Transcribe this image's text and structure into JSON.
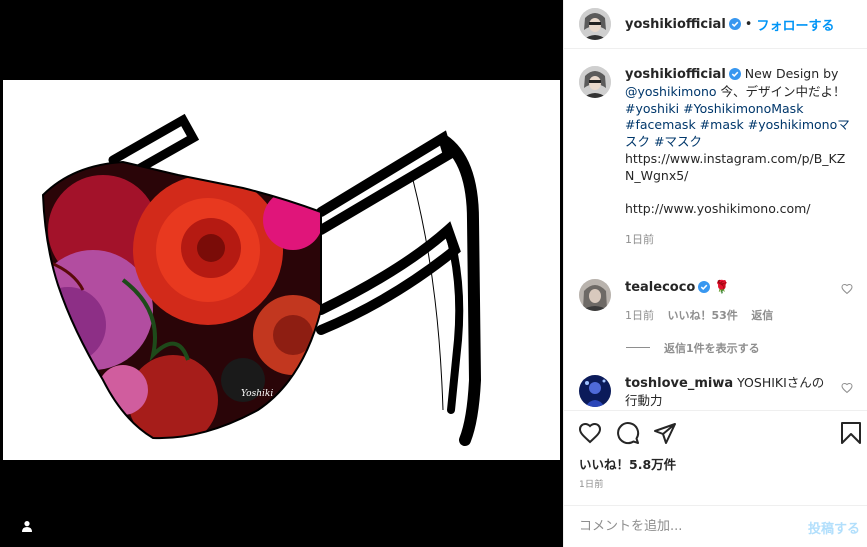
{
  "media": {
    "signature": "Yoshiki",
    "tag_icon": "user-tag-icon"
  },
  "header": {
    "username": "yoshikiofficial",
    "dot": "•",
    "follow_label": "フォローする"
  },
  "caption": {
    "username": "yoshikiofficial",
    "line1_text": " New Design by ",
    "mention": "@yoshikimono",
    "line1_tail": " 今、デザイン中だよ！",
    "tag1": "#yoshiki",
    "tag2": "#YoshikimonoMask",
    "tag3": "#facemask",
    "tag4": "#mask",
    "tag5": "#yoshikimonoマスク",
    "tag6": "#マスク",
    "url1": "https://www.instagram.com/p/B_KZN_Wgnx5/",
    "url2": "http://www.yoshikimono.com/",
    "time": "1日前"
  },
  "comments": [
    {
      "username": "tealecoco",
      "text": "🌹",
      "time": "1日前",
      "likes": "いいね！53件",
      "reply": "返信",
      "view_replies": "返信1件を表示する"
    },
    {
      "username": "toshlove_miwa",
      "text": "YOSHIKIさんの行動力"
    }
  ],
  "actions": {
    "likes": "いいね！5.8万件",
    "time": "1日前"
  },
  "add_comment": {
    "placeholder": "コメントを追加...",
    "post_label": "投稿する"
  },
  "colors": {
    "accent": "#0095f6",
    "link": "#00376b",
    "secondary": "#8e8e8e"
  }
}
